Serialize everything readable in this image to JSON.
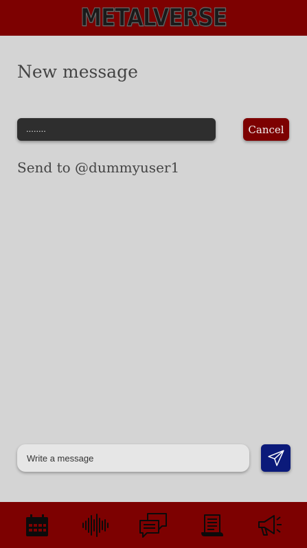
{
  "header": {
    "logo_text": "METALVERSE"
  },
  "page": {
    "title": "New message"
  },
  "recipient": {
    "search_value": "........",
    "cancel_label": "Cancel",
    "send_to": "Send to @dummyuser1"
  },
  "composer": {
    "placeholder": "Write a message",
    "send_icon": "paper-plane-icon"
  },
  "nav": {
    "items": [
      {
        "icon": "calendar-icon"
      },
      {
        "icon": "sound-wave-icon"
      },
      {
        "icon": "chat-bubbles-icon"
      },
      {
        "icon": "scroll-document-icon"
      },
      {
        "icon": "megaphone-icon"
      }
    ]
  },
  "colors": {
    "brand": "#7d0101",
    "send_button": "#0b1a7a",
    "background": "#d4d4d4"
  }
}
